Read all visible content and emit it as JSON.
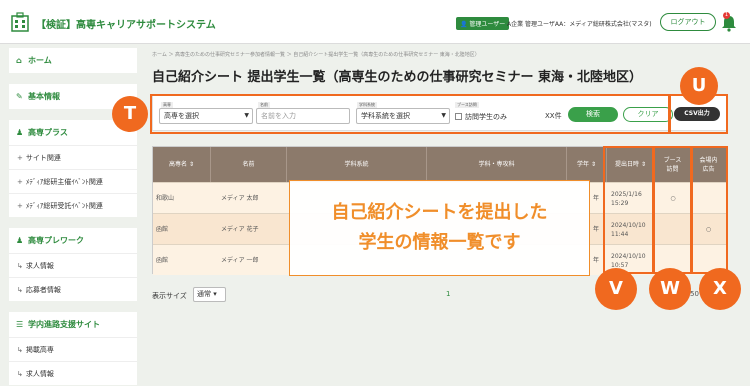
{
  "header": {
    "app_title": "【検証】高専キャリアサポートシステム",
    "role_badge": "管理ユーザー",
    "user_name": "A企業 管理ユーザAA：メディア総研株式会社(マスタ)",
    "logout_label": "ログアウト",
    "notification_count": "1"
  },
  "sidebar": {
    "home": "ホーム",
    "basic_info": "基本情報",
    "kosen_plus": "高専プラス",
    "kosen_plus_items": [
      "サイト関連",
      "ﾒﾃﾞｨｱ総研主催ｲﾍﾞﾝﾄ関連",
      "ﾒﾃﾞｨｱ総研受託ｲﾍﾞﾝﾄ関連"
    ],
    "prework": "高専プレワーク",
    "prework_items": [
      "求人情報",
      "応募者情報"
    ],
    "career_site": "学内進路支援サイト",
    "career_items": [
      "掲載高専",
      "求人情報"
    ]
  },
  "main": {
    "breadcrumb": "ホーム ＞ 高専生のための仕事研究セミナー参加者情報一覧 ＞ 自己紹介シート提出学生一覧（高専生のための仕事研究セミナー 東海・北陸地区）",
    "page_title": "自己紹介シート 提出学生一覧（高専生のための仕事研究セミナー 東海・北陸地区）"
  },
  "filters": {
    "kosen_label": "高専",
    "kosen_value": "高専を選択",
    "name_label": "名前",
    "name_placeholder": "名前を入力",
    "dept_label": "学科系統",
    "dept_value": "学科系統を選択",
    "booth_label": "ブース訪問",
    "booth_checkbox": "訪問学生のみ",
    "count": "XX件",
    "search_label": "検索",
    "clear_label": "クリア",
    "csv_label": "CSV出力"
  },
  "table": {
    "headers": [
      "高専名 ⇕",
      "名前",
      "学科系統",
      "学科・専攻科",
      "学年 ⇕",
      "提出日時 ⇕",
      "ブース\n訪問",
      "会場内\n広告"
    ],
    "rows": [
      {
        "kosen": "和歌山",
        "name": "メディア 太郎",
        "year": "年",
        "date": "2025/1/16\n15:29",
        "booth": "○",
        "ad": ""
      },
      {
        "kosen": "函館",
        "name": "メディア 花子",
        "year": "年",
        "date": "2024/10/10\n11:44",
        "booth": "",
        "ad": "○"
      },
      {
        "kosen": "函館",
        "name": "メディア 一郎",
        "year": "年",
        "date": "2024/10/10\n10:57",
        "booth": "",
        "ad": ""
      }
    ]
  },
  "overlay": {
    "line1": "自己紹介シートを提出した",
    "line2": "学生の情報一覧です"
  },
  "pagination": {
    "page_size_label": "表示サイズ",
    "page_size_value": "通常",
    "current_page": "1",
    "right_text": "50"
  },
  "annotations": [
    "T",
    "U",
    "V",
    "W",
    "X"
  ],
  "colors": {
    "brand": "#2e8b3e",
    "annotation": "#f0691f",
    "table_header": "#8c7a6b"
  }
}
